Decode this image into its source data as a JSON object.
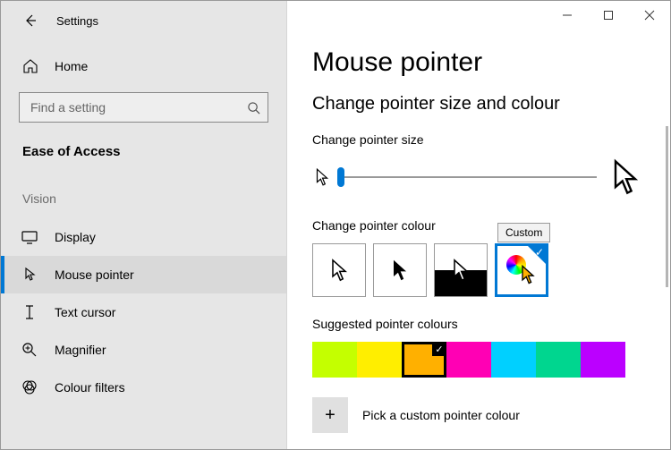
{
  "window": {
    "title": "Settings"
  },
  "sidebar": {
    "home": "Home",
    "search_placeholder": "Find a setting",
    "section": "Ease of Access",
    "subsection": "Vision",
    "items": [
      {
        "label": "Display",
        "icon": "display-icon"
      },
      {
        "label": "Mouse pointer",
        "icon": "pointer-icon"
      },
      {
        "label": "Text cursor",
        "icon": "text-cursor-icon"
      },
      {
        "label": "Magnifier",
        "icon": "magnifier-icon"
      },
      {
        "label": "Colour filters",
        "icon": "colour-filters-icon"
      }
    ],
    "active_index": 1
  },
  "main": {
    "title": "Mouse pointer",
    "subtitle": "Change pointer size and colour",
    "size_label": "Change pointer size",
    "colour_label": "Change pointer colour",
    "tooltip": "Custom",
    "suggested_label": "Suggested pointer colours",
    "custom_label": "Pick a custom pointer colour",
    "colours": [
      "#c4ff00",
      "#ffee00",
      "#ffb000",
      "#ff00b4",
      "#00d0ff",
      "#00d68f",
      "#bb00ff"
    ],
    "selected_colour_index": 2
  }
}
